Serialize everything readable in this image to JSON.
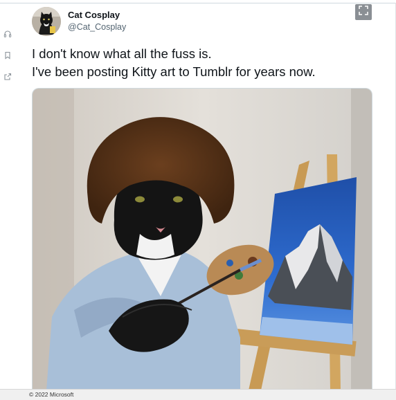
{
  "tweet": {
    "display_name": "Cat Cosplay",
    "handle": "@Cat_Cosplay",
    "text_lines": [
      "I don't know what all the fuss is.",
      "I've been posting Kitty art to Tumblr for years now."
    ],
    "media": {
      "icon": "cat-painting-photo"
    }
  },
  "sidebar": {
    "icons": [
      "headphones-icon",
      "bookmark-icon",
      "share-icon"
    ]
  },
  "toolbar": {
    "expand_icon": "expand-icon"
  },
  "footer": {
    "copyright": "© 2022 Microsoft"
  },
  "colors": {
    "text": "#0f1419",
    "secondary": "#536471",
    "border": "#cfd9de"
  }
}
